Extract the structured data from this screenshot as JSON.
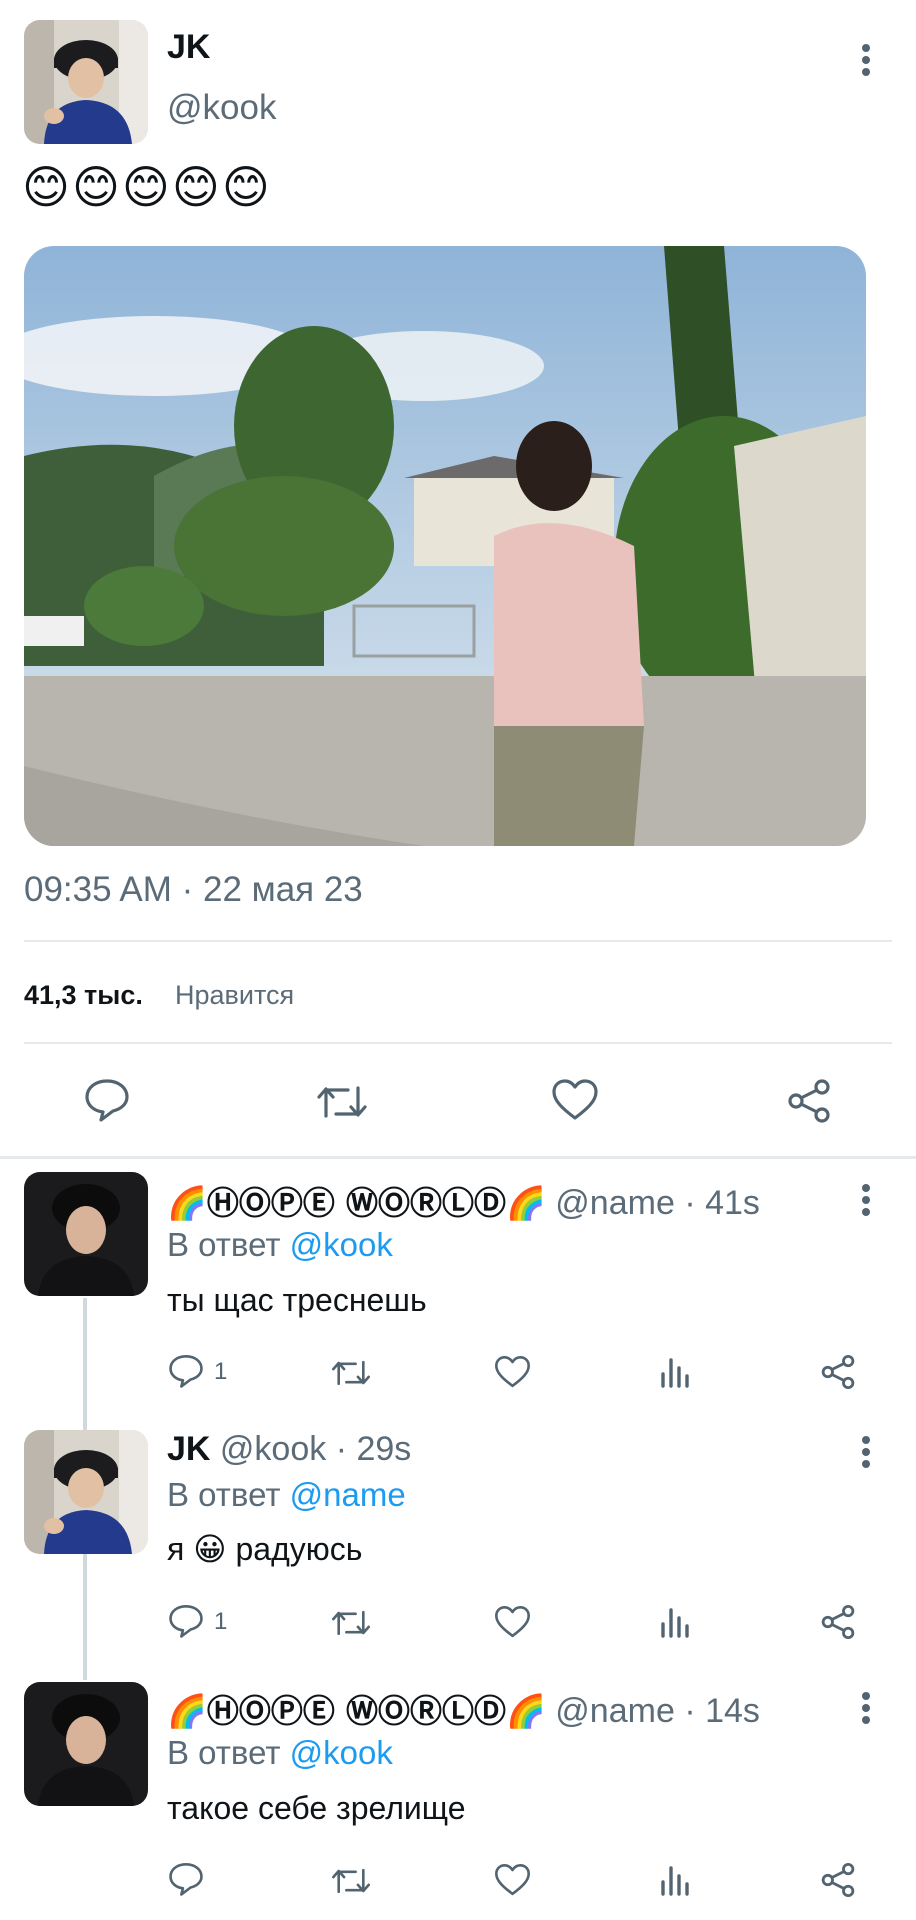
{
  "main_tweet": {
    "display_name": "JK",
    "handle": "@kook",
    "body_emoji": "😊😊😊😊😊",
    "timestamp": "09:35 AM · 22 мая 23",
    "likes_count": "41,3 тыс.",
    "likes_label": "Нравится"
  },
  "replies": [
    {
      "display_name": "🌈ⒽⓄⓅⒺ ⓌⓄⓇⓁⒹ🌈",
      "handle": "@name",
      "time": "· 41s",
      "reply_prefix": "В ответ",
      "reply_to": "@kook",
      "text": "ты щас треснешь",
      "reply_count": "1"
    },
    {
      "display_name": "JK",
      "handle": "@kook",
      "time": "· 29s",
      "reply_prefix": "В ответ",
      "reply_to": "@name",
      "text_before": "я",
      "text_emoji": "😀",
      "text_after": "радуюсь",
      "reply_count": "1"
    },
    {
      "display_name": "🌈ⒽⓄⓅⒺ ⓌⓄⓇⓁⒹ🌈",
      "handle": "@name",
      "time": "· 14s",
      "reply_prefix": "В ответ",
      "reply_to": "@kook",
      "text": "такое себе зрелище",
      "reply_count": ""
    }
  ],
  "icons": {
    "more": "more-vertical-icon",
    "reply": "speech-bubble-icon",
    "retweet": "retweet-icon",
    "like": "heart-icon",
    "views": "bar-chart-icon",
    "share": "share-icon"
  },
  "colors": {
    "link": "#1d9bf0",
    "muted": "#5b6b78",
    "icon": "#536471",
    "divider": "#e6e9eb"
  }
}
